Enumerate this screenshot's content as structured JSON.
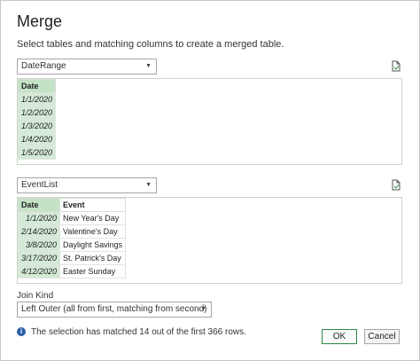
{
  "dialog": {
    "title": "Merge",
    "subtitle": "Select tables and matching columns to create a merged table."
  },
  "first_table": {
    "selected": "DateRange",
    "columns": [
      "Date"
    ],
    "rows": [
      [
        "1/1/2020"
      ],
      [
        "1/2/2020"
      ],
      [
        "1/3/2020"
      ],
      [
        "1/4/2020"
      ],
      [
        "1/5/2020"
      ]
    ]
  },
  "second_table": {
    "selected": "EventList",
    "columns": [
      "Date",
      "Event"
    ],
    "rows": [
      [
        "1/1/2020",
        "New Year's Day"
      ],
      [
        "2/14/2020",
        "Valentine's Day"
      ],
      [
        "3/8/2020",
        "Daylight Savings"
      ],
      [
        "3/17/2020",
        "St. Patrick's Day"
      ],
      [
        "4/12/2020",
        "Easter Sunday"
      ]
    ]
  },
  "join_kind": {
    "label": "Join Kind",
    "selected": "Left Outer (all from first, matching from second)"
  },
  "status": {
    "icon": "info-icon",
    "message": "The selection has matched 14 out of the first 366 rows."
  },
  "buttons": {
    "ok": "OK",
    "cancel": "Cancel"
  },
  "colors": {
    "accent": "#2a8a45",
    "selection": "#d4ead6",
    "info": "#2a5fa8"
  }
}
